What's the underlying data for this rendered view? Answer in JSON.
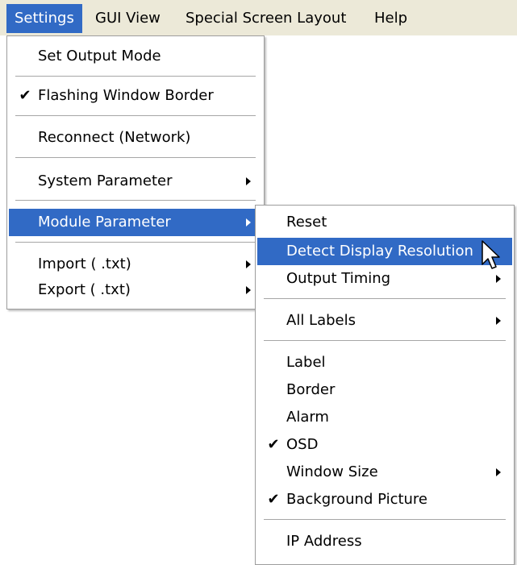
{
  "menubar": {
    "items": [
      "Settings",
      "GUI View",
      "Special Screen Layout",
      "Help"
    ]
  },
  "settings_menu": {
    "items": [
      {
        "label": "Set Output Mode"
      },
      {
        "label": "Flashing Window Border",
        "checked": true
      },
      {
        "label": "Reconnect (Network)"
      },
      {
        "label": "System Parameter",
        "submenu": true
      },
      {
        "label": "Module Parameter",
        "submenu": true,
        "highlighted": true
      },
      {
        "label": "Import ( .txt)",
        "submenu": true
      },
      {
        "label": "Export ( .txt)",
        "submenu": true
      }
    ]
  },
  "module_parameter_menu": {
    "items": [
      {
        "label": "Reset"
      },
      {
        "label": "Detect Display Resolution",
        "highlighted": true
      },
      {
        "label": "Output Timing",
        "submenu": true
      },
      {
        "label": "All Labels",
        "submenu": true
      },
      {
        "label": "Label"
      },
      {
        "label": "Border"
      },
      {
        "label": "Alarm"
      },
      {
        "label": "OSD",
        "checked": true
      },
      {
        "label": "Window Size",
        "submenu": true
      },
      {
        "label": "Background Picture",
        "checked": true
      },
      {
        "label": "IP Address"
      }
    ]
  },
  "glyphs": {
    "check": "✔"
  },
  "colors": {
    "highlight": "#316ac5",
    "menubar_bg": "#ece9d8"
  }
}
